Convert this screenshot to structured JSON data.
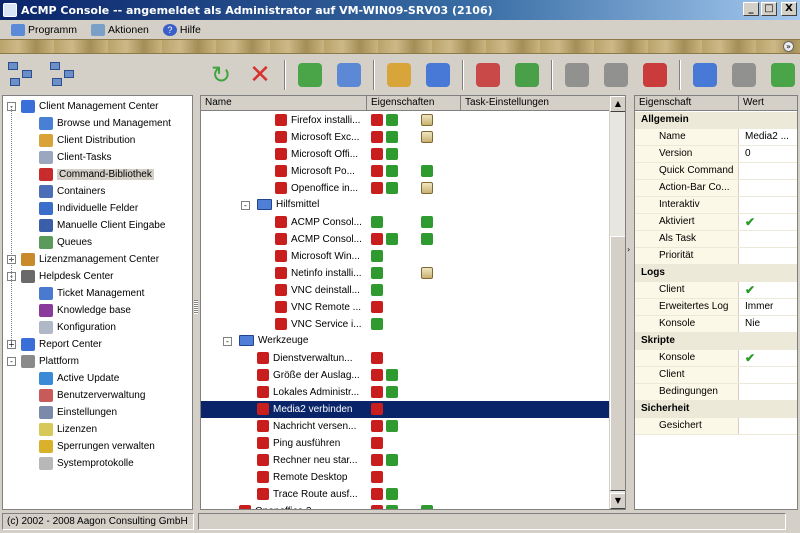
{
  "window": {
    "title": "ACMP Console -- angemeldet als Administrator auf VM-WIN09-SRV03 (2106)",
    "min": "_",
    "max": "□",
    "close": "X"
  },
  "menu": [
    {
      "label": "Programm",
      "icon": "program-icon"
    },
    {
      "label": "Aktionen",
      "icon": "actions-icon"
    },
    {
      "label": "Hilfe",
      "icon": "help-icon"
    }
  ],
  "left_tree": [
    {
      "label": "Client Management Center",
      "level": 0,
      "expander": "-",
      "icon": "client-management-icon",
      "color": "#3a6fd8"
    },
    {
      "label": "Browse und Management",
      "level": 1,
      "icon": "browse-icon",
      "color": "#4a7fd6"
    },
    {
      "label": "Client Distribution",
      "level": 1,
      "icon": "distribution-icon",
      "color": "#d9a33a"
    },
    {
      "label": "Client-Tasks",
      "level": 1,
      "icon": "tasks-icon",
      "color": "#9aa7bf"
    },
    {
      "label": "Command-Bibliothek",
      "level": 1,
      "icon": "command-library-icon",
      "color": "#c82b2b",
      "selected": true
    },
    {
      "label": "Containers",
      "level": 1,
      "icon": "containers-icon",
      "color": "#4a6fb8"
    },
    {
      "label": "Individuelle Felder",
      "level": 1,
      "icon": "custom-fields-icon",
      "color": "#3a6ec8"
    },
    {
      "label": "Manuelle Client Eingabe",
      "level": 1,
      "icon": "manual-entry-icon",
      "color": "#3a5fa8"
    },
    {
      "label": "Queues",
      "level": 1,
      "icon": "queues-icon",
      "color": "#5a9a5a"
    },
    {
      "label": "Lizenzmanagement Center",
      "level": 0,
      "expander": "+",
      "icon": "license-center-icon",
      "color": "#c88a2a"
    },
    {
      "label": "Helpdesk Center",
      "level": 0,
      "expander": "-",
      "icon": "helpdesk-icon",
      "color": "#6a6a6a"
    },
    {
      "label": "Ticket Management",
      "level": 1,
      "icon": "ticket-icon",
      "color": "#4a7ad0"
    },
    {
      "label": "Knowledge base",
      "level": 1,
      "icon": "knowledge-icon",
      "color": "#8a3a9a"
    },
    {
      "label": "Konfiguration",
      "level": 1,
      "icon": "configuration-icon",
      "color": "#b0b8c8"
    },
    {
      "label": "Report Center",
      "level": 0,
      "expander": "+",
      "icon": "report-icon",
      "color": "#3a6fd8"
    },
    {
      "label": "Plattform",
      "level": 0,
      "expander": "-",
      "icon": "platform-icon",
      "color": "#8a8a8a"
    },
    {
      "label": "Active Update",
      "level": 1,
      "icon": "update-icon",
      "color": "#3a8ad8"
    },
    {
      "label": "Benutzerverwaltung",
      "level": 1,
      "icon": "users-icon",
      "color": "#c85a5a"
    },
    {
      "label": "Einstellungen",
      "level": 1,
      "icon": "settings-icon",
      "color": "#7a8aa8"
    },
    {
      "label": "Lizenzen",
      "level": 1,
      "icon": "licenses-icon",
      "color": "#d8c85a"
    },
    {
      "label": "Sperrungen verwalten",
      "level": 1,
      "icon": "lock-icon",
      "color": "#d8b02a"
    },
    {
      "label": "Systemprotokolle",
      "level": 1,
      "icon": "logs-icon",
      "color": "#b8b8b8"
    }
  ],
  "center": {
    "columns": [
      "Name",
      "Eigenschaften",
      "Task-Einstellungen"
    ],
    "rows": [
      {
        "label": "Firefox installi...",
        "indent": 3,
        "icons": [
          "red",
          "green"
        ],
        "task": [
          "paper"
        ]
      },
      {
        "label": "Microsoft Exc...",
        "indent": 3,
        "icons": [
          "red",
          "green"
        ],
        "task": [
          "paper"
        ]
      },
      {
        "label": "Microsoft Offi...",
        "indent": 3,
        "icons": [
          "red",
          "green"
        ],
        "task": []
      },
      {
        "label": "Microsoft Po...",
        "indent": 3,
        "icons": [
          "red",
          "green"
        ],
        "task": [
          "green"
        ]
      },
      {
        "label": "Openoffice in...",
        "indent": 3,
        "icons": [
          "red",
          "green"
        ],
        "task": [
          "paper"
        ]
      },
      {
        "label": "Hilfsmittel",
        "indent": 2,
        "folder": true,
        "expander": "-",
        "icons": [],
        "task": []
      },
      {
        "label": "ACMP Consol...",
        "indent": 3,
        "icons": [
          "green"
        ],
        "task": [
          "green"
        ]
      },
      {
        "label": "ACMP Consol...",
        "indent": 3,
        "icons": [
          "red",
          "green"
        ],
        "task": [
          "green"
        ]
      },
      {
        "label": "Microsoft Win...",
        "indent": 3,
        "icons": [
          "green"
        ],
        "task": []
      },
      {
        "label": "Netinfo installi...",
        "indent": 3,
        "icons": [
          "green"
        ],
        "task": [
          "paper"
        ]
      },
      {
        "label": "VNC deinstall...",
        "indent": 3,
        "icons": [
          "green"
        ],
        "task": []
      },
      {
        "label": "VNC Remote ...",
        "indent": 3,
        "icons": [
          "red"
        ],
        "task": []
      },
      {
        "label": "VNC Service i...",
        "indent": 3,
        "icons": [
          "green"
        ],
        "task": []
      },
      {
        "label": "Werkzeuge",
        "indent": 1,
        "folder": true,
        "expander": "-",
        "icons": [],
        "task": []
      },
      {
        "label": "Dienstverwaltun...",
        "indent": 2,
        "icons": [
          "red"
        ],
        "task": []
      },
      {
        "label": "Größe der Auslag...",
        "indent": 2,
        "icons": [
          "red",
          "green"
        ],
        "task": []
      },
      {
        "label": "Lokales Administr...",
        "indent": 2,
        "icons": [
          "red",
          "green"
        ],
        "task": []
      },
      {
        "label": "Media2 verbinden",
        "indent": 2,
        "icons": [
          "red"
        ],
        "task": [],
        "selected": true
      },
      {
        "label": "Nachricht versen...",
        "indent": 2,
        "icons": [
          "red",
          "green"
        ],
        "task": []
      },
      {
        "label": "Ping ausführen",
        "indent": 2,
        "icons": [
          "red"
        ],
        "task": []
      },
      {
        "label": "Rechner neu star...",
        "indent": 2,
        "icons": [
          "red",
          "green"
        ],
        "task": []
      },
      {
        "label": "Remote Desktop",
        "indent": 2,
        "icons": [
          "red"
        ],
        "task": []
      },
      {
        "label": "Trace Route ausf...",
        "indent": 2,
        "icons": [
          "red",
          "green"
        ],
        "task": []
      },
      {
        "label": "Openoffice 3",
        "indent": 1,
        "icons": [
          "red",
          "green"
        ],
        "task": [
          "green"
        ]
      }
    ],
    "scroll": {
      "up": "▲",
      "down": "▼"
    }
  },
  "properties": {
    "columns": [
      "Eigenschaft",
      "Wert"
    ],
    "rows": [
      {
        "cat": "Allgemein"
      },
      {
        "name": "Name",
        "value": "Media2 ..."
      },
      {
        "name": "Version",
        "value": "0"
      },
      {
        "name": "Quick Command",
        "value": ""
      },
      {
        "name": "Action-Bar Co...",
        "value": ""
      },
      {
        "name": "Interaktiv",
        "value": ""
      },
      {
        "name": "Aktiviert",
        "value": "✔",
        "check": true
      },
      {
        "name": "Als Task",
        "value": ""
      },
      {
        "name": "Priorität",
        "value": ""
      },
      {
        "cat": "Logs"
      },
      {
        "name": "Client",
        "value": "✔",
        "check": true
      },
      {
        "name": "Erweitertes Log",
        "value": "Immer"
      },
      {
        "name": "Konsole",
        "value": "Nie"
      },
      {
        "cat": "Skripte"
      },
      {
        "name": "Konsole",
        "value": "✔",
        "check": true
      },
      {
        "name": "Client",
        "value": ""
      },
      {
        "name": "Bedingungen",
        "value": ""
      },
      {
        "cat": "Sicherheit"
      },
      {
        "name": "Gesichert",
        "value": ""
      }
    ]
  },
  "toolbar": [
    {
      "name": "refresh-icon",
      "color": "#2fa02f"
    },
    {
      "name": "delete-icon",
      "color": "#d82020"
    },
    {
      "sep": true
    },
    {
      "name": "new-command-icon",
      "color": "#3aa03a"
    },
    {
      "name": "open-folder-icon",
      "color": "#4f7fd6"
    },
    {
      "sep": true
    },
    {
      "name": "wizard-icon",
      "color": "#d8a02a"
    },
    {
      "name": "wizard-sparkle-icon",
      "color": "#3a6fd8"
    },
    {
      "sep": true
    },
    {
      "name": "shapes-icon",
      "color": "#c83a3a"
    },
    {
      "name": "script-function-icon",
      "color": "#3a9a3a"
    },
    {
      "sep": true
    },
    {
      "name": "puzzle-grey-icon",
      "color": "#8a8a8a"
    },
    {
      "name": "puzzle-grey2-icon",
      "color": "#8a8a8a"
    },
    {
      "name": "puzzle-red-icon",
      "color": "#c82b2b"
    },
    {
      "sep": true
    },
    {
      "name": "list-view-icon",
      "color": "#3a6fd8"
    },
    {
      "name": "comment-icon",
      "color": "#8a8a8a"
    },
    {
      "name": "package-icon",
      "color": "#3aa03a"
    }
  ],
  "status": {
    "copyright": "(c) 2002 - 2008 Aagon Consulting GmbH"
  }
}
